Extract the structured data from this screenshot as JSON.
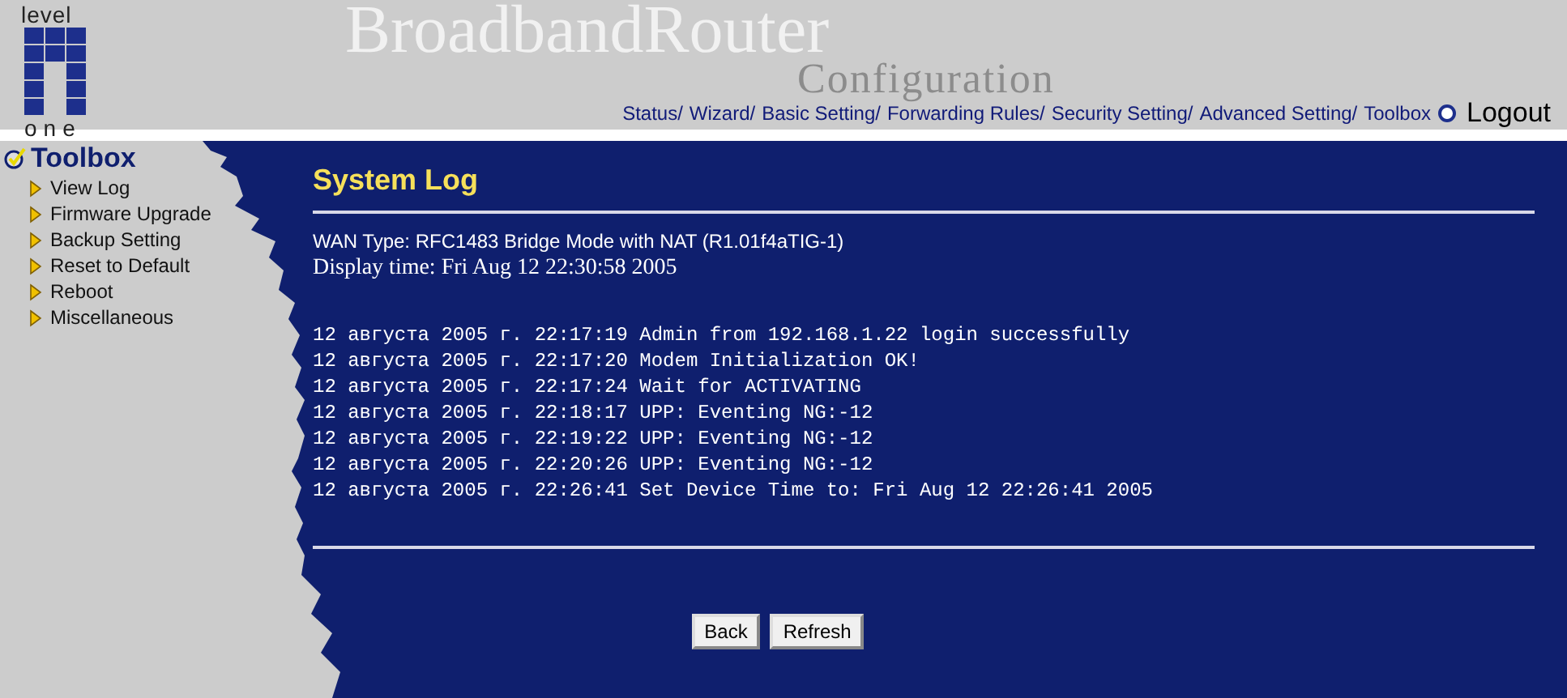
{
  "header": {
    "logo_top": "level",
    "logo_bottom": "one",
    "title": "BroadbandRouter",
    "subtitle": "Configuration",
    "nav": [
      "Status/",
      "Wizard/",
      "Basic Setting/",
      "Forwarding Rules/",
      "Security Setting/",
      "Advanced Setting/",
      "Toolbox"
    ],
    "logout": "Logout"
  },
  "sidebar": {
    "heading": "Toolbox",
    "items": [
      "View Log",
      "Firmware Upgrade",
      "Backup Setting",
      "Reset to Default",
      "Reboot",
      "Miscellaneous"
    ]
  },
  "main": {
    "title": "System Log",
    "wan_type": "WAN Type: RFC1483 Bridge Mode with NAT (R1.01f4aTIG-1)",
    "display_time": "Display time: Fri Aug 12 22:30:58 2005",
    "log_lines": [
      "12 августа 2005 г. 22:17:19 Admin from 192.168.1.22 login successfully",
      "12 августа 2005 г. 22:17:20 Modem Initialization OK!",
      "12 августа 2005 г. 22:17:24 Wait for ACTIVATING",
      "12 августа 2005 г. 22:18:17 UPP: Eventing NG:-12",
      "12 августа 2005 г. 22:19:22 UPP: Eventing NG:-12",
      "12 августа 2005 г. 22:20:26 UPP: Eventing NG:-12",
      "12 августа 2005 г. 22:26:41 Set Device Time to: Fri Aug 12 22:26:41 2005"
    ],
    "buttons": [
      "Back",
      "Refresh"
    ]
  }
}
